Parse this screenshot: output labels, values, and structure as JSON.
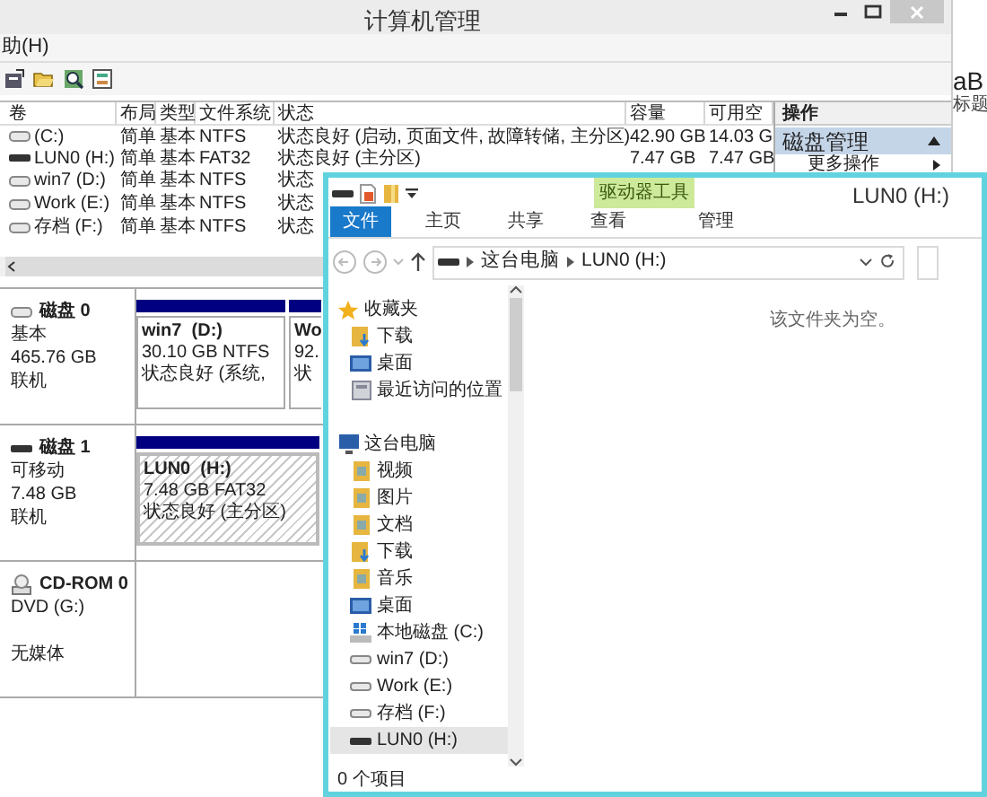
{
  "background_window": {
    "title": "计算机管理",
    "menu": [
      "助(H)"
    ],
    "volume_table": {
      "columns": [
        "卷",
        "布局",
        "类型",
        "文件系统",
        "状态",
        "容量",
        "可用空"
      ],
      "rows": [
        {
          "kind": "fixed",
          "cells": [
            "(C:)",
            "简单",
            "基本",
            "NTFS",
            "状态良好 (启动, 页面文件, 故障转储, 主分区)",
            "42.90 GB",
            "14.03 G"
          ]
        },
        {
          "kind": "usb",
          "cells": [
            "LUN0 (H:)",
            "简单",
            "基本",
            "FAT32",
            "状态良好 (主分区)",
            "7.47 GB",
            "7.47 GB"
          ]
        },
        {
          "kind": "fixed",
          "cells": [
            "win7 (D:)",
            "简单",
            "基本",
            "NTFS",
            "状态"
          ]
        },
        {
          "kind": "fixed",
          "cells": [
            "Work (E:)",
            "简单",
            "基本",
            "NTFS",
            "状态"
          ]
        },
        {
          "kind": "fixed",
          "cells": [
            "存档 (F:)",
            "简单",
            "基本",
            "NTFS",
            "状态"
          ]
        }
      ]
    },
    "disks": [
      {
        "kind": "fixed",
        "name": "磁盘 0",
        "lines": [
          "基本",
          "465.76 GB",
          "联机"
        ],
        "partitions": [
          {
            "selected": false,
            "name": "win7  (D:)",
            "lines": [
              "30.10 GB NTFS",
              "状态良好 (系统,"
            ]
          },
          {
            "selected": false,
            "name": "Wo",
            "lines": [
              "92.",
              "状"
            ]
          }
        ]
      },
      {
        "kind": "usb",
        "name": "磁盘 1",
        "lines": [
          "可移动",
          "7.48 GB",
          "联机"
        ],
        "partitions": [
          {
            "selected": true,
            "name": "LUN0  (H:)",
            "lines": [
              "7.48 GB FAT32",
              "状态良好 (主分区)"
            ]
          }
        ]
      },
      {
        "kind": "cdrom",
        "name": "CD-ROM 0",
        "lines": [
          "DVD (G:)",
          "无媒体"
        ]
      }
    ],
    "actions": {
      "header": "操作",
      "section": "磁盘管理",
      "items": [
        "更多操作"
      ]
    },
    "window_behind": {
      "texts": [
        "aB",
        "标题"
      ]
    }
  },
  "explorer": {
    "context_tab": "驱动器工具",
    "title": "LUN0 (H:)",
    "tabs": [
      {
        "label": "文件",
        "selected": true
      },
      {
        "label": "主页",
        "selected": false
      },
      {
        "label": "共享",
        "selected": false
      },
      {
        "label": "查看",
        "selected": false
      },
      {
        "label": "管理",
        "selected": false
      }
    ],
    "address": [
      "这台电脑",
      "LUN0 (H:)"
    ],
    "nav": [
      {
        "label": "收藏夹",
        "kind": "star",
        "selected": false,
        "children": [
          {
            "label": "下载",
            "kind": "download",
            "selected": false
          },
          {
            "label": "桌面",
            "kind": "desktop",
            "selected": false
          },
          {
            "label": "最近访问的位置",
            "kind": "recent",
            "selected": false
          }
        ]
      },
      {
        "label": "这台电脑",
        "kind": "pc",
        "selected": false,
        "children": [
          {
            "label": "视频",
            "kind": "folder",
            "selected": false
          },
          {
            "label": "图片",
            "kind": "folder",
            "selected": false
          },
          {
            "label": "文档",
            "kind": "folder",
            "selected": false
          },
          {
            "label": "下载",
            "kind": "download",
            "selected": false
          },
          {
            "label": "音乐",
            "kind": "folder",
            "selected": false
          },
          {
            "label": "桌面",
            "kind": "desktop",
            "selected": false
          },
          {
            "label": "本地磁盘 (C:)",
            "kind": "system",
            "selected": false
          },
          {
            "label": "win7 (D:)",
            "kind": "drive",
            "selected": false
          },
          {
            "label": "Work (E:)",
            "kind": "drive",
            "selected": false
          },
          {
            "label": "存档 (F:)",
            "kind": "drive",
            "selected": false
          },
          {
            "label": "LUN0 (H:)",
            "kind": "usb",
            "selected": true
          }
        ]
      }
    ],
    "empty_message": "该文件夹为空。",
    "status": "0 个项目"
  }
}
